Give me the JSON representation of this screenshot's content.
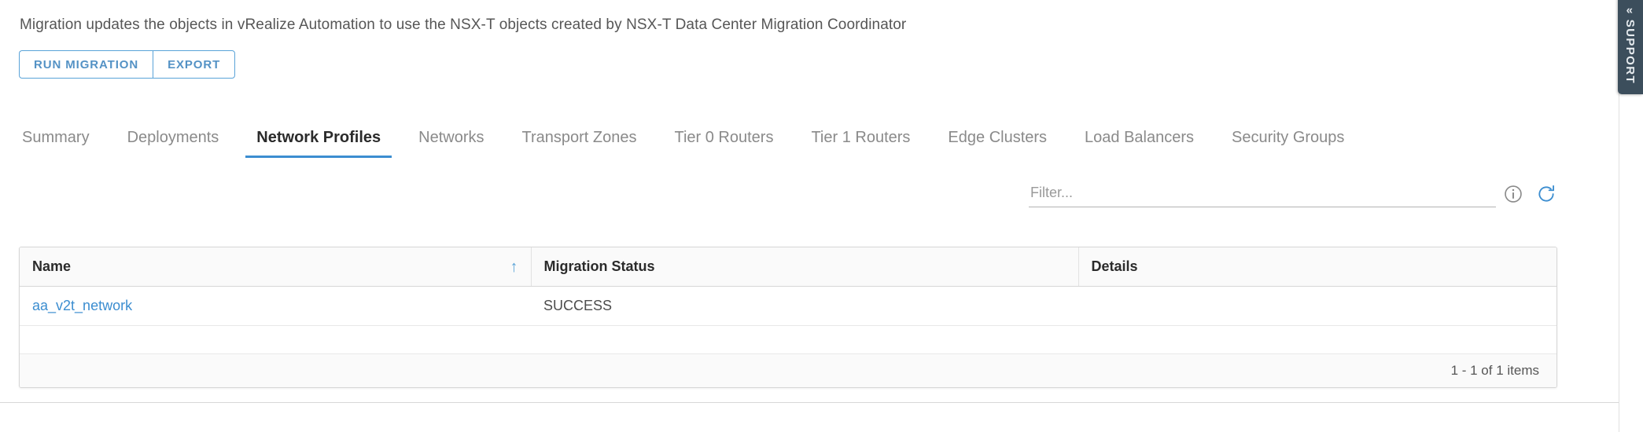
{
  "page": {
    "description": "Migration updates the objects in vRealize Automation to use the NSX-T objects created by NSX-T Data Center Migration Coordinator"
  },
  "actions": {
    "run_migration_label": "RUN MIGRATION",
    "export_label": "EXPORT"
  },
  "tabs": {
    "active": "Network Profiles",
    "items": [
      {
        "label": "Summary"
      },
      {
        "label": "Deployments"
      },
      {
        "label": "Network Profiles"
      },
      {
        "label": "Networks"
      },
      {
        "label": "Transport Zones"
      },
      {
        "label": "Tier 0 Routers"
      },
      {
        "label": "Tier 1 Routers"
      },
      {
        "label": "Edge Clusters"
      },
      {
        "label": "Load Balancers"
      },
      {
        "label": "Security Groups"
      }
    ]
  },
  "filter": {
    "placeholder": "Filter...",
    "value": "",
    "info_icon": "info-icon",
    "refresh_icon": "refresh-icon"
  },
  "table": {
    "columns": [
      {
        "label": "Name",
        "sorted": true,
        "sort_icon": "↑"
      },
      {
        "label": "Migration Status",
        "sorted": false,
        "sort_icon": ""
      },
      {
        "label": "Details",
        "sorted": false,
        "sort_icon": ""
      }
    ],
    "rows": [
      {
        "name": "aa_v2t_network",
        "migration_status": "SUCCESS",
        "details": ""
      }
    ],
    "footer": "1 - 1 of 1 items"
  },
  "support": {
    "label": "SUPPORT",
    "chevron": "«"
  },
  "colors": {
    "accent_blue": "#3b8dd0",
    "button_blue": "#5492c5",
    "button_border": "#5aa3d8",
    "text_dark": "#2b2b2b",
    "text_muted": "#8a8a8a",
    "support_bg": "#3c4e5c",
    "table_border": "#d6d6d6"
  }
}
